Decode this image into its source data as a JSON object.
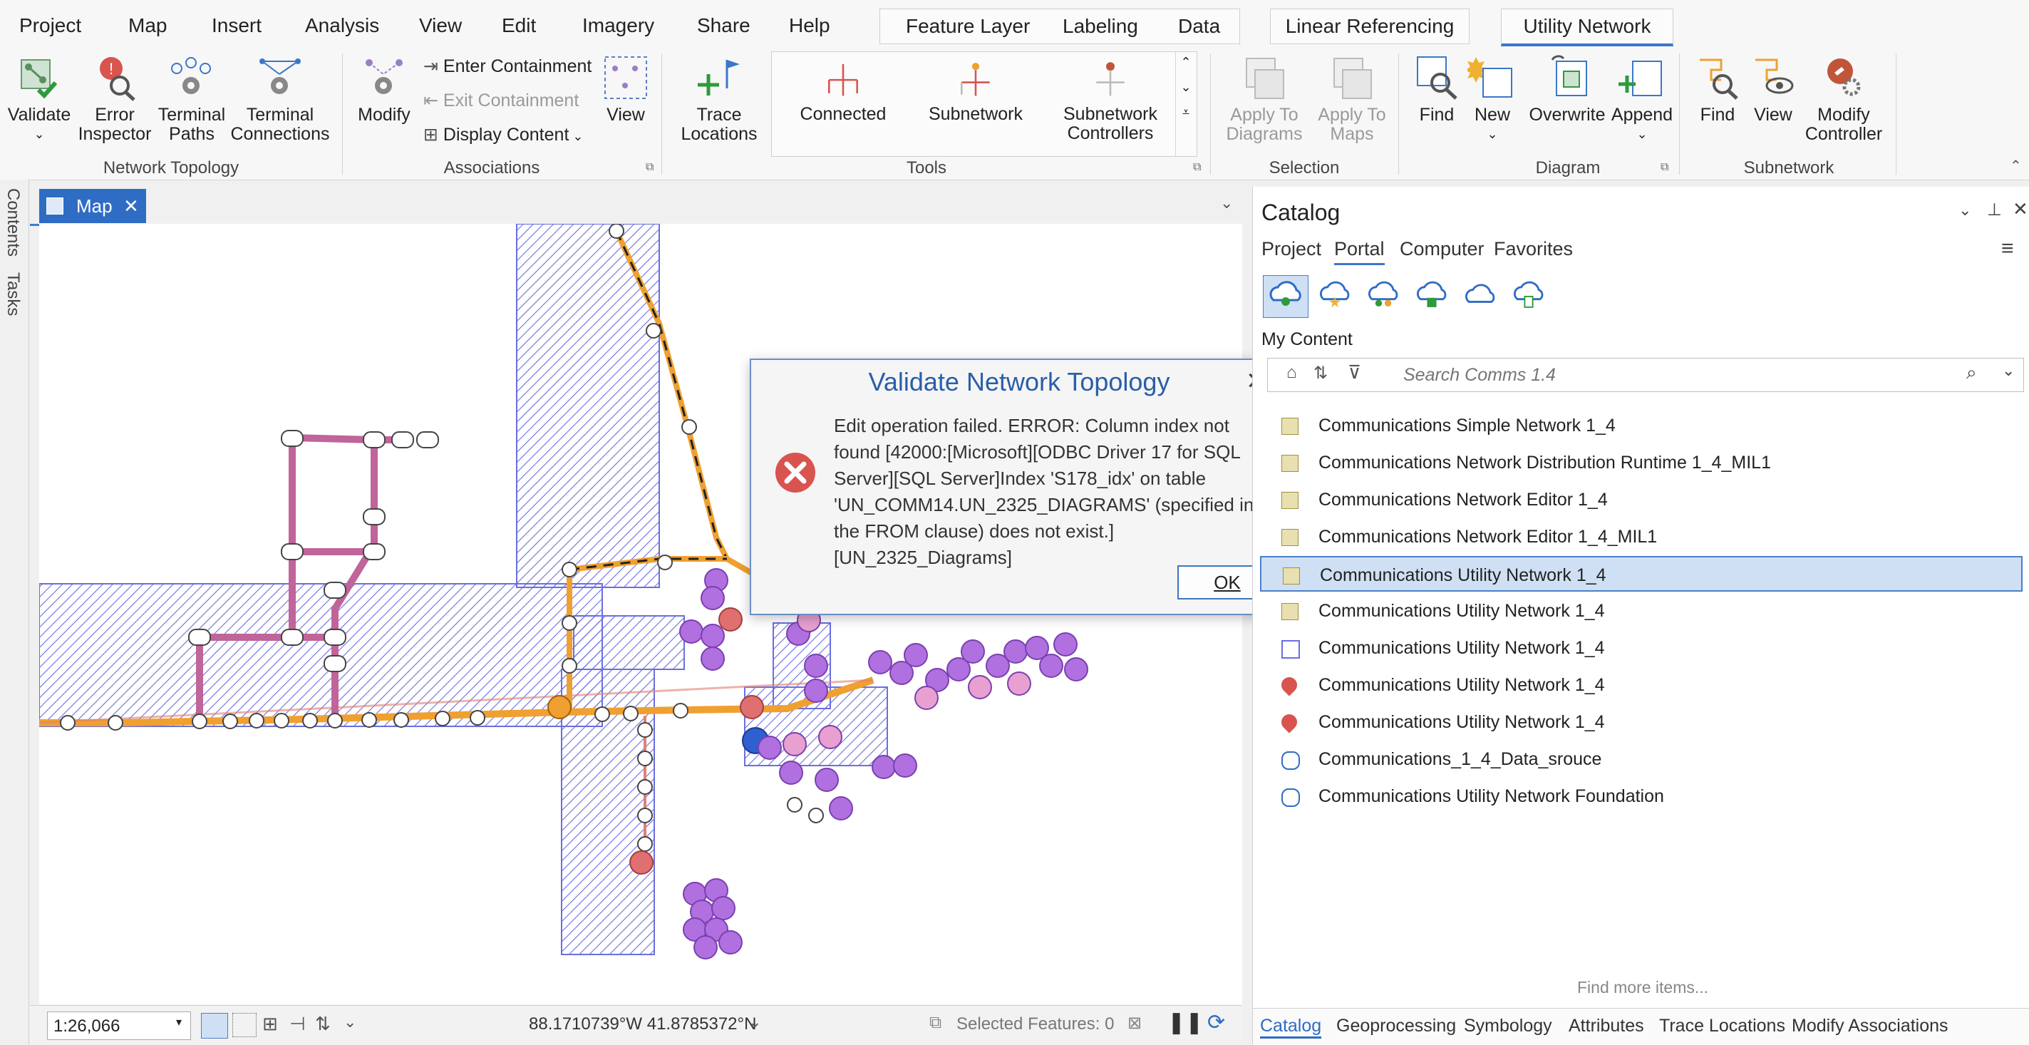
{
  "menu": {
    "items": [
      "Project",
      "Map",
      "Insert",
      "Analysis",
      "View",
      "Edit",
      "Imagery",
      "Share",
      "Help"
    ],
    "context_tabs": [
      "Feature Layer",
      "Labeling",
      "Data",
      "Linear Referencing",
      "Utility Network"
    ],
    "active_context_tab": "Utility Network"
  },
  "ribbon": {
    "network_topology": {
      "label": "Network Topology",
      "validate": "Validate",
      "error_inspector": [
        "Error",
        "Inspector"
      ],
      "terminal_paths": [
        "Terminal",
        "Paths"
      ],
      "terminal_connections": [
        "Terminal",
        "Connections"
      ]
    },
    "associations": {
      "label": "Associations",
      "modify": "Modify",
      "enter_containment": "Enter Containment",
      "exit_containment": "Exit Containment",
      "display_content": "Display Content",
      "view": "View"
    },
    "tools": {
      "label": "Tools",
      "trace_locations": [
        "Trace",
        "Locations"
      ],
      "connected": "Connected",
      "subnetwork": "Subnetwork",
      "subnetwork_controllers": [
        "Subnetwork",
        "Controllers"
      ]
    },
    "selection": {
      "label": "Selection",
      "apply_to_diagrams": [
        "Apply To",
        "Diagrams"
      ],
      "apply_to_maps": [
        "Apply To",
        "Maps"
      ]
    },
    "diagram": {
      "label": "Diagram",
      "find": "Find",
      "new": "New",
      "overwrite": "Overwrite",
      "append": "Append"
    },
    "subnetwork": {
      "label": "Subnetwork",
      "find": "Find",
      "view": "View",
      "modify_controller": [
        "Modify",
        "Controller"
      ]
    }
  },
  "left_strip": [
    "Contents",
    "Tasks"
  ],
  "map": {
    "tab_label": "Map",
    "scale": "1:26,066",
    "coordinates": "88.1710739°W 41.8785372°N",
    "selected_features": "Selected Features: 0"
  },
  "dialog": {
    "title": "Validate Network Topology",
    "message": "Edit operation failed. ERROR: Column index not found [42000:[Microsoft][ODBC Driver 17 for SQL Server][SQL Server]Index 'S178_idx' on table 'UN_COMM14.UN_2325_DIAGRAMS' (specified in the FROM clause) does not exist.] [UN_2325_Diagrams]",
    "ok_label": "OK"
  },
  "catalog": {
    "title": "Catalog",
    "tabs": [
      "Project",
      "Portal",
      "Computer",
      "Favorites"
    ],
    "active_tab": "Portal",
    "section": "My Content",
    "search_placeholder": "Search Comms 1.4",
    "items": [
      "Communications Simple Network 1_4",
      "Communications Network Distribution Runtime 1_4_MIL1",
      "Communications Network Editor 1_4",
      "Communications Network Editor 1_4_MIL1",
      "Communications Utility Network 1_4",
      "Communications Utility Network 1_4",
      "Communications Utility Network 1_4",
      "Communications Utility Network 1_4",
      "Communications Utility Network 1_4",
      "Communications_1_4_Data_srouce",
      "Communications Utility Network Foundation"
    ],
    "selected_index": 4,
    "find_more": "Find more items...",
    "bottom_tabs": [
      "Catalog",
      "Geoprocessing",
      "Symbology",
      "Attributes",
      "Trace Locations",
      "Modify Associations"
    ],
    "active_bottom_tab": "Catalog"
  },
  "colors": {
    "accent": "#2f6cc4",
    "error_red": "#d9534f",
    "hatch_blue": "#6a6ee0",
    "line_orange": "#f0a030",
    "line_mauve": "#c0649a",
    "point_purple": "#b070e0"
  }
}
